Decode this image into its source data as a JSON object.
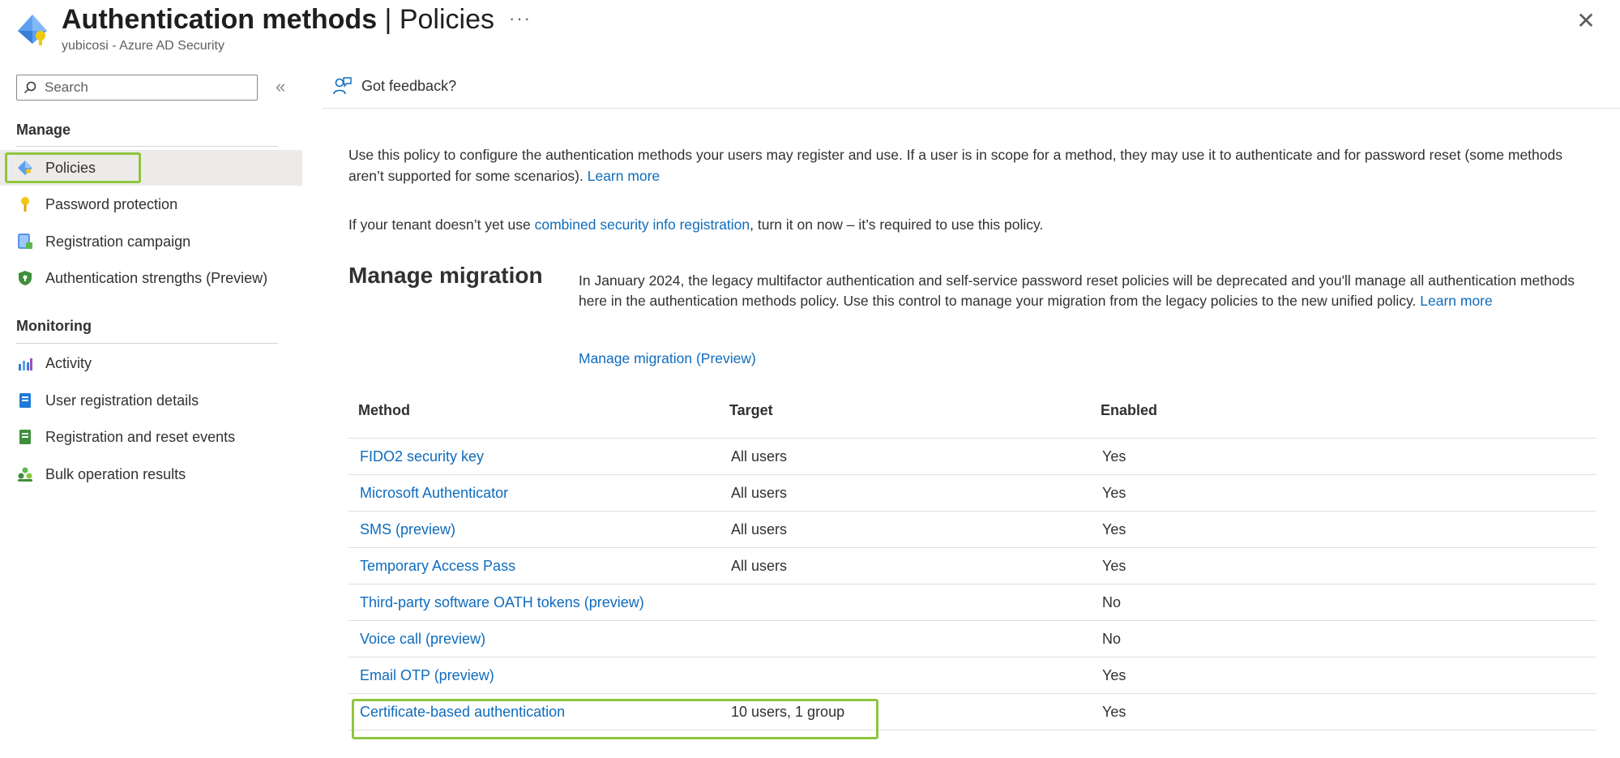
{
  "header": {
    "title_bold": "Authentication methods",
    "title_rest": " | Policies",
    "more": "···",
    "subtitle": "yubicosi - Azure AD Security",
    "close": "✕"
  },
  "sidebar": {
    "search_placeholder": "Search",
    "collapse": "«",
    "sections": [
      {
        "label": "Manage"
      },
      {
        "label": "Monitoring"
      }
    ],
    "items": [
      {
        "label": "Policies",
        "icon": "policies-icon",
        "active": true
      },
      {
        "label": "Password protection",
        "icon": "key-icon"
      },
      {
        "label": "Registration campaign",
        "icon": "registration-campaign-icon"
      },
      {
        "label": "Authentication strengths (Preview)",
        "icon": "shield-icon"
      },
      {
        "label": "Activity",
        "icon": "activity-chart-icon"
      },
      {
        "label": "User registration details",
        "icon": "user-details-icon"
      },
      {
        "label": "Registration and reset events",
        "icon": "events-icon"
      },
      {
        "label": "Bulk operation results",
        "icon": "bulk-users-icon"
      }
    ]
  },
  "toolbar": {
    "feedback_label": "Got feedback?"
  },
  "main": {
    "intro_text": "Use this policy to configure the authentication methods your users may register and use. If a user is in scope for a method, they may use it to authenticate and for password reset (some methods aren’t supported for some scenarios). ",
    "intro_link": "Learn more",
    "tenant_text_1": "If your tenant doesn’t yet use ",
    "tenant_link": "combined security info registration",
    "tenant_text_2": ", turn it on now – it’s required to use this policy.",
    "migration": {
      "title": "Manage migration",
      "text": "In January 2024, the legacy multifactor authentication and self-service password reset policies will be deprecated and you'll manage all authentication methods here in the authentication methods policy. Use this control to manage your migration from the legacy policies to the new unified policy. ",
      "learn_link": "Learn more",
      "manage_link": "Manage migration (Preview)"
    },
    "table": {
      "headers": [
        "Method",
        "Target",
        "Enabled"
      ],
      "rows": [
        {
          "method": "FIDO2 security key",
          "target": "All users",
          "enabled": "Yes"
        },
        {
          "method": "Microsoft Authenticator",
          "target": "All users",
          "enabled": "Yes"
        },
        {
          "method": "SMS (preview)",
          "target": "All users",
          "enabled": "Yes"
        },
        {
          "method": "Temporary Access Pass",
          "target": "All users",
          "enabled": "Yes"
        },
        {
          "method": "Third-party software OATH tokens (preview)",
          "target": "",
          "enabled": "No"
        },
        {
          "method": "Voice call (preview)",
          "target": "",
          "enabled": "No"
        },
        {
          "method": "Email OTP (preview)",
          "target": "",
          "enabled": "Yes"
        },
        {
          "method": "Certificate-based authentication",
          "target": "10 users, 1 group",
          "enabled": "Yes"
        }
      ]
    }
  },
  "colors": {
    "link": "#0f6cbd",
    "highlight": "#8dc63f",
    "active_bg": "#edebe9"
  }
}
